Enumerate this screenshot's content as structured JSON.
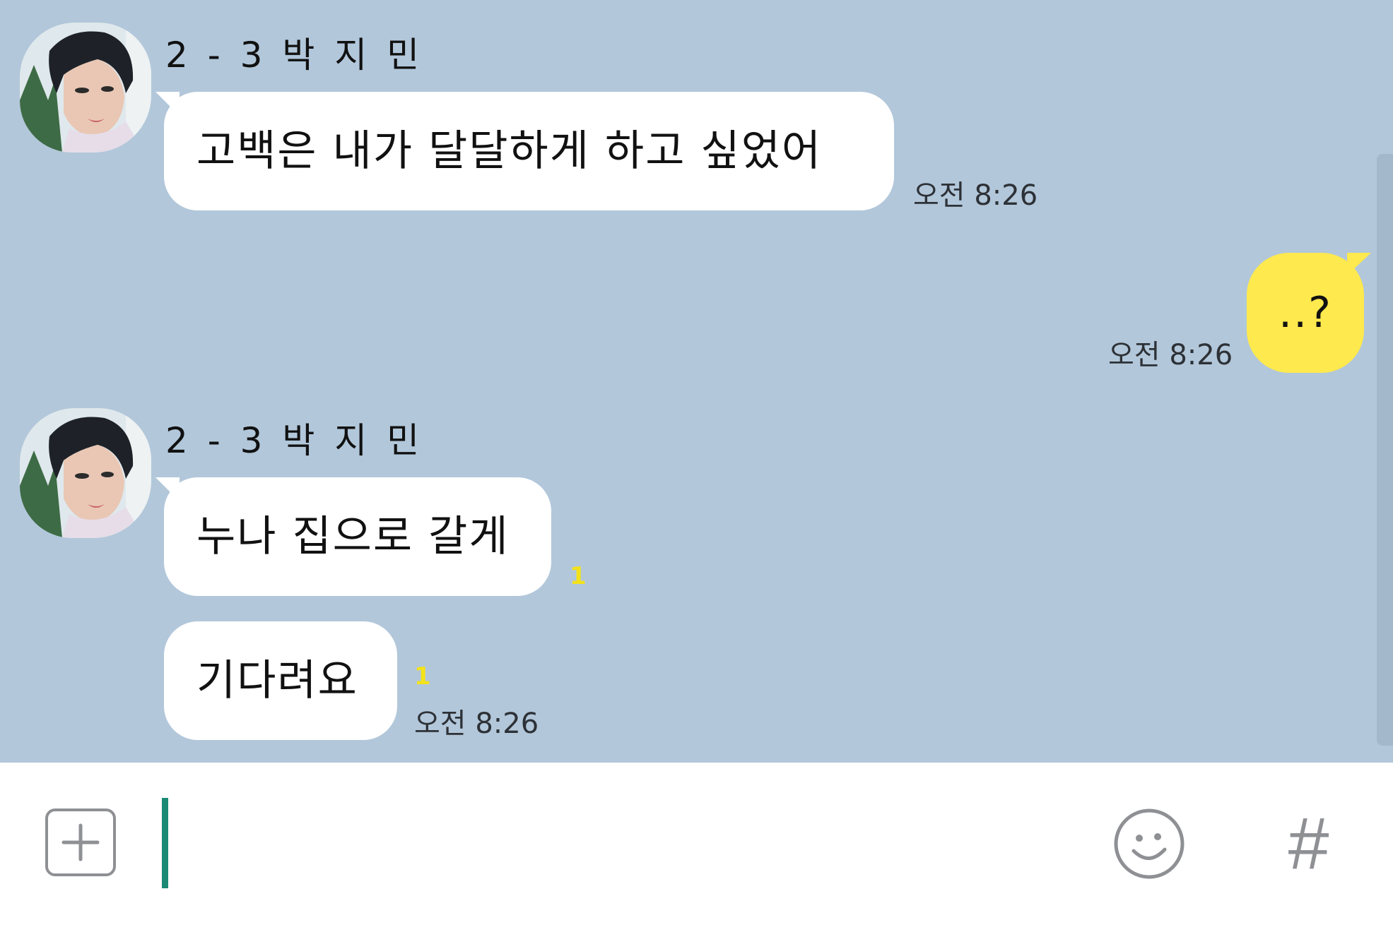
{
  "messages": [
    {
      "sender": "2 - 3 박 지 민",
      "text": "고백은 내가 달달하게 하고 싶었어",
      "time": "오전 8:26"
    },
    {
      "sender": "me",
      "text": "..?",
      "time": "오전 8:26"
    },
    {
      "sender": "2 - 3 박 지 민",
      "text": "누나 집으로 갈게",
      "unread": "1"
    },
    {
      "sender": "2 - 3 박 지 민",
      "text": "기다려요",
      "unread": "1",
      "time": "오전 8:26"
    }
  ],
  "input": {
    "value": "",
    "placeholder": "",
    "plus_icon": "plus-icon",
    "emoji_icon": "smiley-icon",
    "hash_label": "#"
  },
  "colors": {
    "chat_background": "#b2c7da",
    "my_bubble": "#fee94e",
    "their_bubble": "#ffffff",
    "unread_count": "#f3e21a",
    "caret": "#1a8a74"
  }
}
